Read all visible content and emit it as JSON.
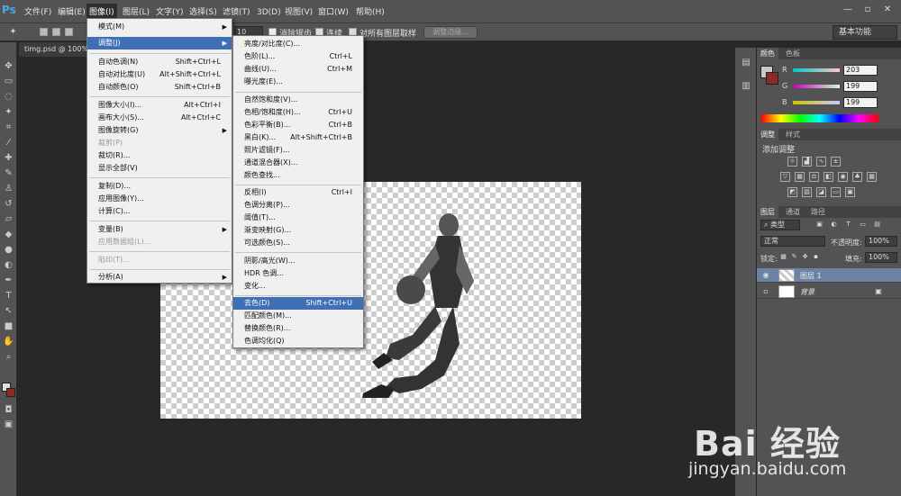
{
  "app": {
    "logo": "Ps"
  },
  "menubar": {
    "items": [
      "文件(F)",
      "编辑(E)",
      "图像(I)",
      "图层(L)",
      "文字(Y)",
      "选择(S)",
      "滤镜(T)",
      "3D(D)",
      "视图(V)",
      "窗口(W)",
      "帮助(H)"
    ]
  },
  "window_controls": {
    "minimize": "—",
    "restore": "▫",
    "close": "✕"
  },
  "options_bar": {
    "size_value": "10",
    "anti_alias_label": "消除锯齿",
    "contiguous_label": "连续",
    "sample_all_layers_label": "对所有图层取样",
    "refine_edge_label": "调整边缘...",
    "workspace": "基本功能"
  },
  "document": {
    "tab_title": "timg.psd @ 100%"
  },
  "image_menu": [
    {
      "label": "模式(M)",
      "shortcut": "",
      "submenu": true
    },
    {
      "label": "调整(J)",
      "shortcut": "",
      "submenu": true,
      "highlight": true
    },
    {
      "label": "自动色调(N)",
      "shortcut": "Shift+Ctrl+L"
    },
    {
      "label": "自动对比度(U)",
      "shortcut": "Alt+Shift+Ctrl+L"
    },
    {
      "label": "自动颜色(O)",
      "shortcut": "Shift+Ctrl+B"
    },
    {
      "label": "图像大小(I)...",
      "shortcut": "Alt+Ctrl+I"
    },
    {
      "label": "画布大小(S)...",
      "shortcut": "Alt+Ctrl+C"
    },
    {
      "label": "图像旋转(G)",
      "shortcut": "",
      "submenu": true
    },
    {
      "label": "裁剪(P)",
      "shortcut": "",
      "disabled": true
    },
    {
      "label": "裁切(R)...",
      "shortcut": ""
    },
    {
      "label": "显示全部(V)",
      "shortcut": ""
    },
    {
      "label": "复制(D)...",
      "shortcut": ""
    },
    {
      "label": "应用图像(Y)...",
      "shortcut": ""
    },
    {
      "label": "计算(C)...",
      "shortcut": ""
    },
    {
      "label": "变量(B)",
      "shortcut": "",
      "submenu": true
    },
    {
      "label": "应用数据组(L)...",
      "shortcut": "",
      "disabled": true
    },
    {
      "label": "陷印(T)...",
      "shortcut": "",
      "disabled": true
    },
    {
      "label": "分析(A)",
      "shortcut": "",
      "submenu": true
    }
  ],
  "adjust_menu": [
    {
      "label": "亮度/对比度(C)...",
      "shortcut": ""
    },
    {
      "label": "色阶(L)...",
      "shortcut": "Ctrl+L"
    },
    {
      "label": "曲线(U)...",
      "shortcut": "Ctrl+M"
    },
    {
      "label": "曝光度(E)...",
      "shortcut": ""
    },
    {
      "label": "自然饱和度(V)...",
      "shortcut": ""
    },
    {
      "label": "色相/饱和度(H)...",
      "shortcut": "Ctrl+U"
    },
    {
      "label": "色彩平衡(B)...",
      "shortcut": "Ctrl+B"
    },
    {
      "label": "黑白(K)...",
      "shortcut": "Alt+Shift+Ctrl+B"
    },
    {
      "label": "照片滤镜(F)...",
      "shortcut": ""
    },
    {
      "label": "通道混合器(X)...",
      "shortcut": ""
    },
    {
      "label": "颜色查找...",
      "shortcut": ""
    },
    {
      "label": "反相(I)",
      "shortcut": "Ctrl+I"
    },
    {
      "label": "色调分离(P)...",
      "shortcut": ""
    },
    {
      "label": "阈值(T)...",
      "shortcut": ""
    },
    {
      "label": "渐变映射(G)...",
      "shortcut": ""
    },
    {
      "label": "可选颜色(S)...",
      "shortcut": ""
    },
    {
      "label": "阴影/高光(W)...",
      "shortcut": ""
    },
    {
      "label": "HDR 色调...",
      "shortcut": ""
    },
    {
      "label": "变化...",
      "shortcut": ""
    },
    {
      "label": "去色(D)",
      "shortcut": "Shift+Ctrl+U",
      "highlight": true
    },
    {
      "label": "匹配颜色(M)...",
      "shortcut": ""
    },
    {
      "label": "替换颜色(R)...",
      "shortcut": ""
    },
    {
      "label": "色调均化(Q)",
      "shortcut": ""
    }
  ],
  "color_panel": {
    "tabs": [
      "颜色",
      "色板"
    ],
    "labels": [
      "R",
      "G",
      "B"
    ],
    "values": [
      "203",
      "199",
      "199"
    ],
    "foreground": "#cbc7c7",
    "background": "#8b2a26"
  },
  "adjustments_panel": {
    "tabs": [
      "调整",
      "样式"
    ],
    "title": "添加调整"
  },
  "layers_panel": {
    "tabs": [
      "图层",
      "通道",
      "路径"
    ],
    "filter_kind": "类型",
    "blend_mode": "正常",
    "opacity_label": "不透明度:",
    "opacity_value": "100%",
    "lock_label": "锁定:",
    "fill_label": "填充:",
    "fill_value": "100%",
    "layers": [
      {
        "name": "图层 1",
        "selected": true
      },
      {
        "name": "背景",
        "selected": false
      }
    ]
  },
  "watermark": {
    "brand": "Bai 经验",
    "site": "jingyan.baidu.com"
  },
  "colors": {
    "menu_highlight": "#3f6fb5",
    "chrome": "#535353",
    "workspace": "#282828"
  }
}
